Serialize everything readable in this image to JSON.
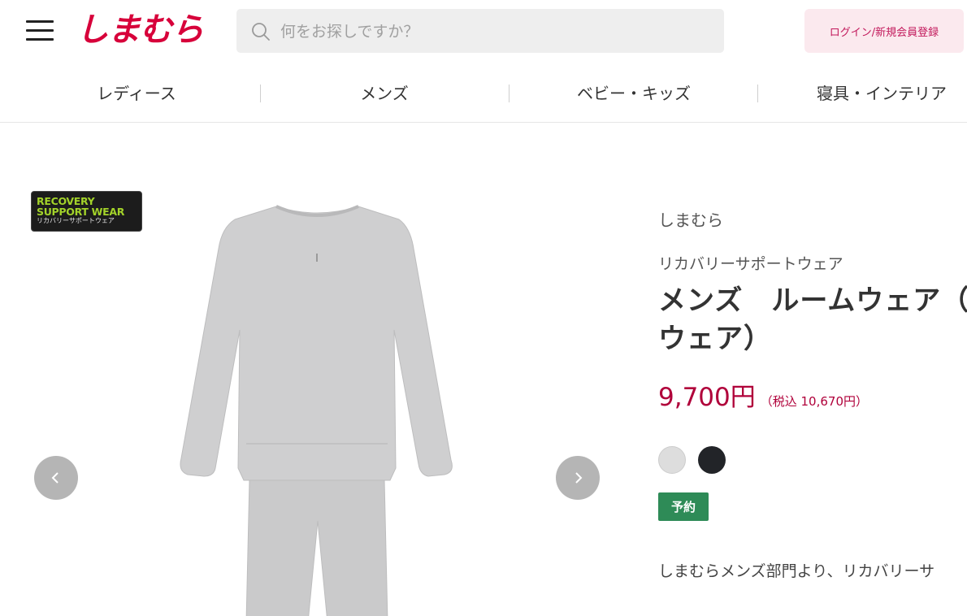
{
  "header": {
    "logo_text": "しまむら",
    "search_placeholder": "何をお探しですか？",
    "login_label": "ログイン/新規会員登録"
  },
  "nav": {
    "items": [
      {
        "label": "レディース"
      },
      {
        "label": "メンズ"
      },
      {
        "label": "ベビー・キッズ"
      },
      {
        "label": "寝具・インテリア"
      }
    ]
  },
  "gallery": {
    "badge_line1": "RECOVERY",
    "badge_line2": "SUPPORT WEAR",
    "badge_line3": "リカバリーサポートウェア"
  },
  "product": {
    "brand": "しまむら",
    "subtitle": "リカバリーサポートウェア",
    "title_line1": "メンズ　ルームウェア（",
    "title_line2": "ウェア）",
    "price": "9,700円",
    "price_tax": "（税込 10,670円）",
    "tag": "予約",
    "description": "しまむらメンズ部門より、リカバリーサ"
  },
  "colors": {
    "brand_red": "#d7003a",
    "price_red": "#b0003a",
    "login_bg": "#fbe9ee",
    "login_text": "#c2185b",
    "tag_green": "#2e8b57",
    "arrow_gray": "#b5b5b5",
    "badge_green": "#a3d32a",
    "swatch_gray": "#dddddd",
    "swatch_black": "#222428",
    "garment_gray": "#cfcfd0"
  }
}
